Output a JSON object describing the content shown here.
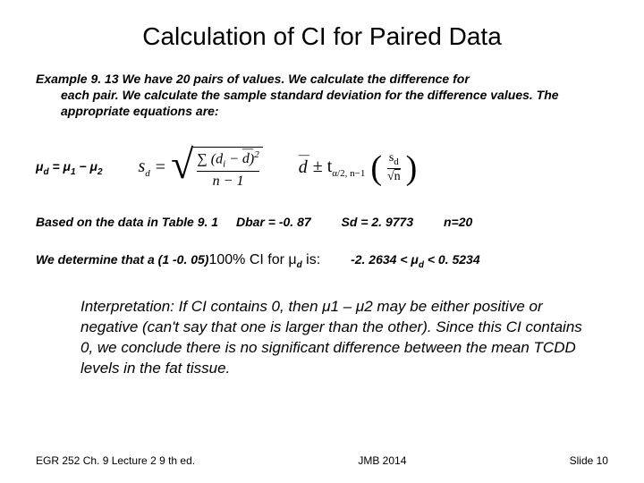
{
  "title": "Calculation of CI for Paired Data",
  "example": {
    "lead": "Example 9. 13   We have 20 pairs of values.  We calculate the difference for",
    "cont": "each pair. We calculate the sample standard deviation for the difference values. The appropriate equations are:"
  },
  "mu": {
    "pre": "μ",
    "d": "d",
    "eq": " = μ",
    "one": "1",
    "minus": " − μ",
    "two": "2"
  },
  "sd_formula": {
    "lhs": "s",
    "lhs_sub": "d",
    "eq": " = ",
    "num": "∑ (d",
    "num_i": "i",
    "num_mid": " − ",
    "num_dbar": "d",
    "num_end": ")",
    "num_sq": "2",
    "den": "n − 1"
  },
  "ci_formula": {
    "dbar": "d",
    "pm": " ± t",
    "tsub": "α/2, n−1",
    "s": "s",
    "s_sub": "d",
    "sqrtn": "n"
  },
  "data_row": {
    "based": "Based on the data in Table 9. 1",
    "dbar_lbl": "Dbar",
    "dbar_val": " = -0. 87",
    "sd_lbl": "Sd",
    "sd_val": " = 2. 9773",
    "n": "n=20"
  },
  "determine": {
    "pre": "We determine that a (1 -0. 05)",
    "pct": "100% CI for μ",
    "d": "d",
    "is": " is:",
    "range": "-2. 2634  <   μ",
    "d2": "d",
    "range2": "   <   0. 5234"
  },
  "interpretation": "Interpretation: If CI contains 0, then μ1 – μ2 may be either positive or negative (can't say that one is larger than the other).  Since this CI contains 0, we conclude there is no significant difference between the mean TCDD levels in the fat tissue.",
  "footer": {
    "left": "EGR 252  Ch. 9  Lecture 2  9 th ed.",
    "center": "JMB 2014",
    "right": "Slide  10"
  }
}
